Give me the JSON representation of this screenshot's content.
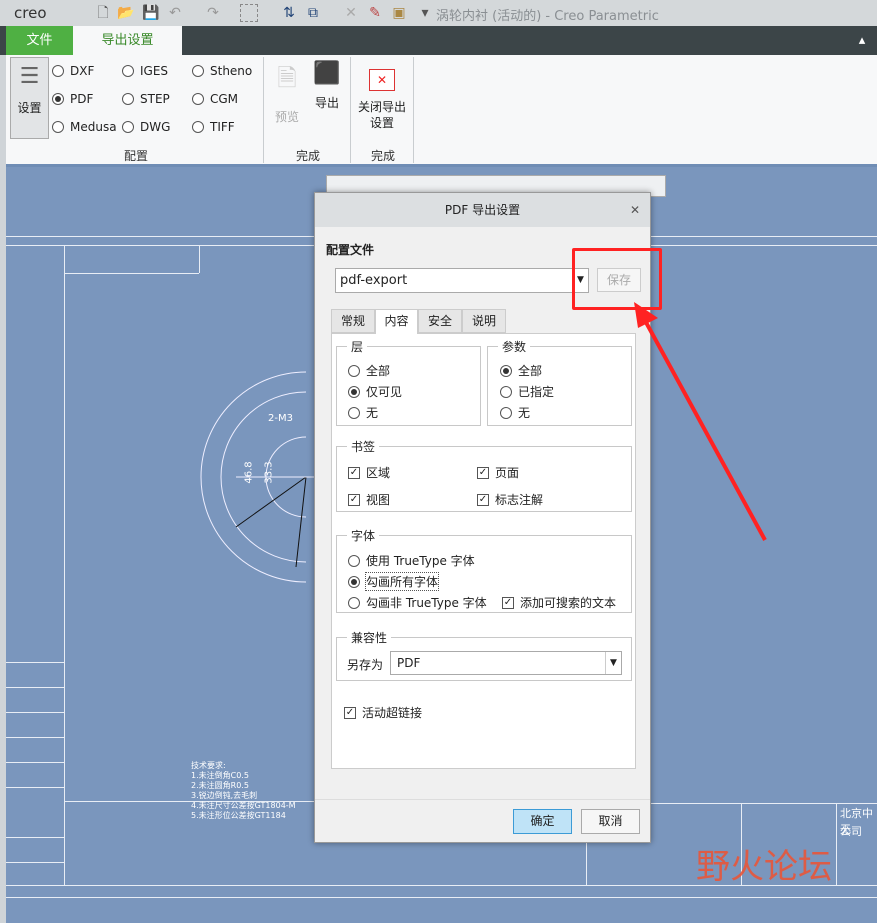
{
  "titlebar": {
    "logo": "creo",
    "title": "涡轮内衬 (活动的) - Creo Parametric"
  },
  "tabs": {
    "file": "文件",
    "export": "导出设置"
  },
  "ribbon": {
    "settings": "设置",
    "formats": [
      {
        "label": "DXF",
        "on": false
      },
      {
        "label": "IGES",
        "on": false
      },
      {
        "label": "Stheno",
        "on": false
      },
      {
        "label": "PDF",
        "on": true
      },
      {
        "label": "STEP",
        "on": false
      },
      {
        "label": "CGM",
        "on": false
      },
      {
        "label": "Medusa",
        "on": false
      },
      {
        "label": "DWG",
        "on": false
      },
      {
        "label": "TIFF",
        "on": false
      }
    ],
    "group_config": "配置",
    "preview": "预览",
    "export": "导出",
    "group_finish": "完成",
    "close_export": "关闭导出",
    "close_export2": "设置",
    "group_finish2": "完成"
  },
  "dialog": {
    "title": "PDF 导出设置",
    "profile_label": "配置文件",
    "profile_value": "pdf-export",
    "save": "保存",
    "tabs": [
      "常规",
      "内容",
      "安全",
      "说明"
    ],
    "layers": {
      "title": "层",
      "options": [
        "全部",
        "仅可见",
        "无"
      ],
      "selected": 1
    },
    "params": {
      "title": "参数",
      "options": [
        "全部",
        "已指定",
        "无"
      ],
      "selected": 0
    },
    "bookmarks": {
      "title": "书签",
      "items": [
        "区域",
        "页面",
        "视图",
        "标志注解"
      ]
    },
    "fonts": {
      "title": "字体",
      "options": [
        "使用 TrueType 字体",
        "勾画所有字体",
        "勾画非 TrueType 字体"
      ],
      "selected": 1,
      "searchable": "添加可搜索的文本"
    },
    "compat": {
      "title": "兼容性",
      "save_as_label": "另存为",
      "save_as_value": "PDF"
    },
    "hyperlinks": "活动超链接",
    "ok": "确定",
    "cancel": "取消"
  },
  "drawing": {
    "notes": [
      "技术要求:",
      "1.未注倒角C0.5",
      "2.未注圆角R0.5",
      "3.锐边倒钝,去毛刺",
      "4.未注尺寸公差按GT1804-M",
      "5.未注形位公差按GT1184"
    ],
    "company": "北京中无",
    "company2": "公司",
    "dim1": "46.8",
    "dim2": "33.3",
    "label": "2-M3"
  },
  "watermark": "野火论坛"
}
